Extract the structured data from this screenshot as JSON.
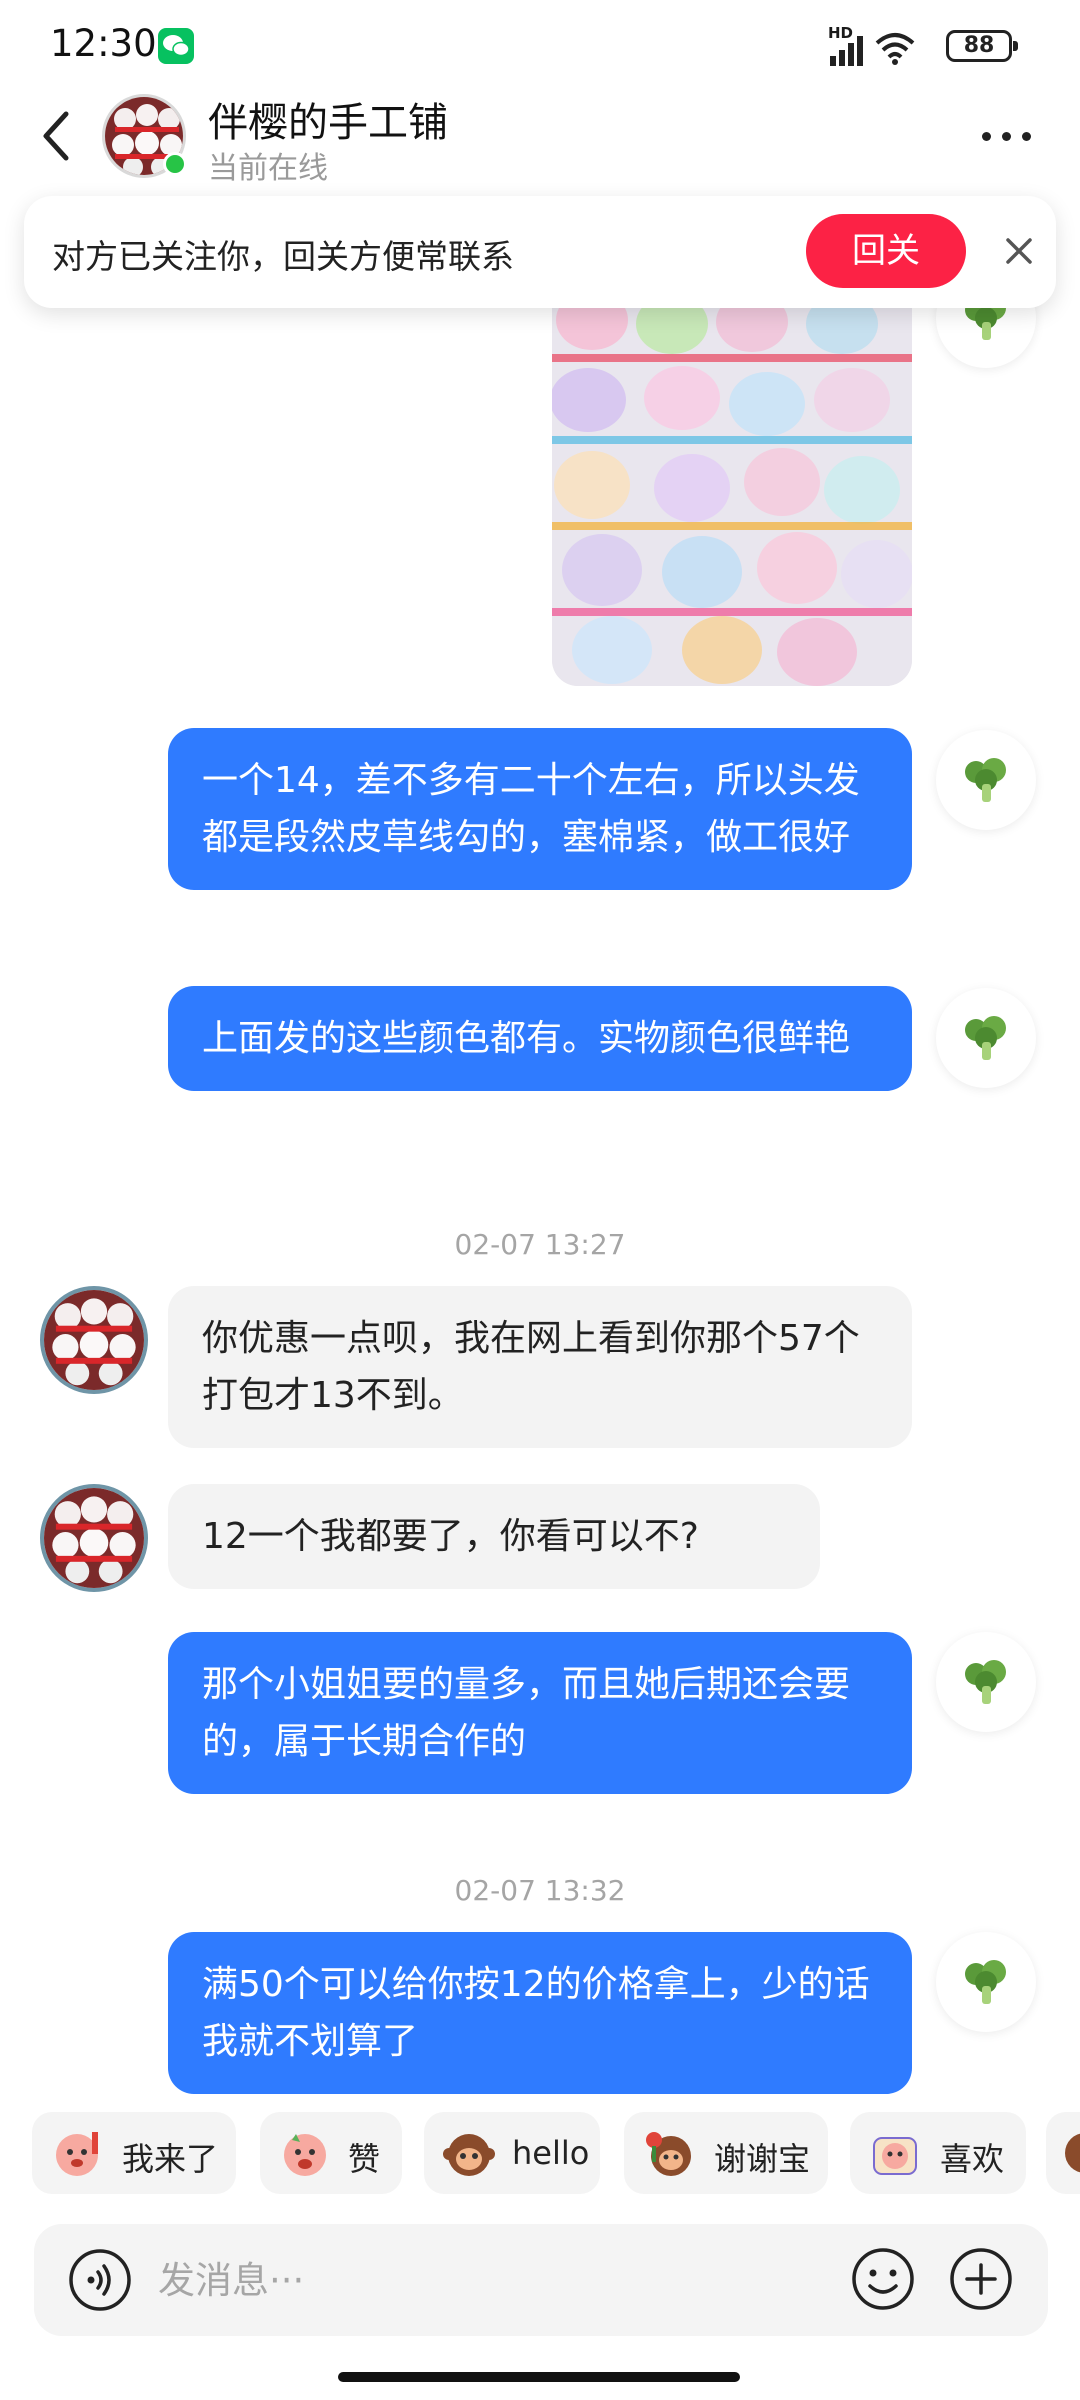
{
  "status_bar": {
    "time": "12:30",
    "network": "HD",
    "battery": "88",
    "icons": [
      "wechat-icon",
      "signal-icon",
      "wifi-icon",
      "battery-icon"
    ]
  },
  "header": {
    "contact_name": "伴樱的手工铺",
    "contact_status": "当前在线",
    "icons": [
      "back-icon",
      "more-icon"
    ]
  },
  "follow_banner": {
    "text": "对方已关注你，回关方便常联系",
    "button": "回关",
    "close_icon": "close-icon",
    "button_color": "#fc2245"
  },
  "messages": [
    {
      "sender": "me",
      "text": "一个14，差不多有二十个左右，所以头发都是段然皮草线勾的，塞棉紧，做工很好"
    },
    {
      "sender": "me",
      "text": "上面发的这些颜色都有。实物颜色很鲜艳"
    },
    {
      "type": "timestamp",
      "text": "02-07 13:27"
    },
    {
      "sender": "other",
      "text": "你优惠一点呗，我在网上看到你那个57个打包才13不到。"
    },
    {
      "sender": "other",
      "text": "12一个我都要了，你看可以不?"
    },
    {
      "sender": "me",
      "text": "那个小姐姐要的量多，而且她后期还会要的，属于长期合作的"
    },
    {
      "type": "timestamp",
      "text": "02-07 13:32"
    },
    {
      "sender": "me",
      "text": "满50个可以给你按12的价格拿上，少的话我就不划算了"
    }
  ],
  "quick_replies": [
    "我来了",
    "赞",
    "hello",
    "谢谢宝",
    "喜欢"
  ],
  "input": {
    "placeholder": "发消息···",
    "icons": [
      "voice-icon",
      "emoji-icon",
      "add-icon"
    ]
  },
  "colors": {
    "my_bubble": "#2f7bff",
    "other_bubble": "#f3f3f3",
    "online_dot": "#27c446"
  }
}
